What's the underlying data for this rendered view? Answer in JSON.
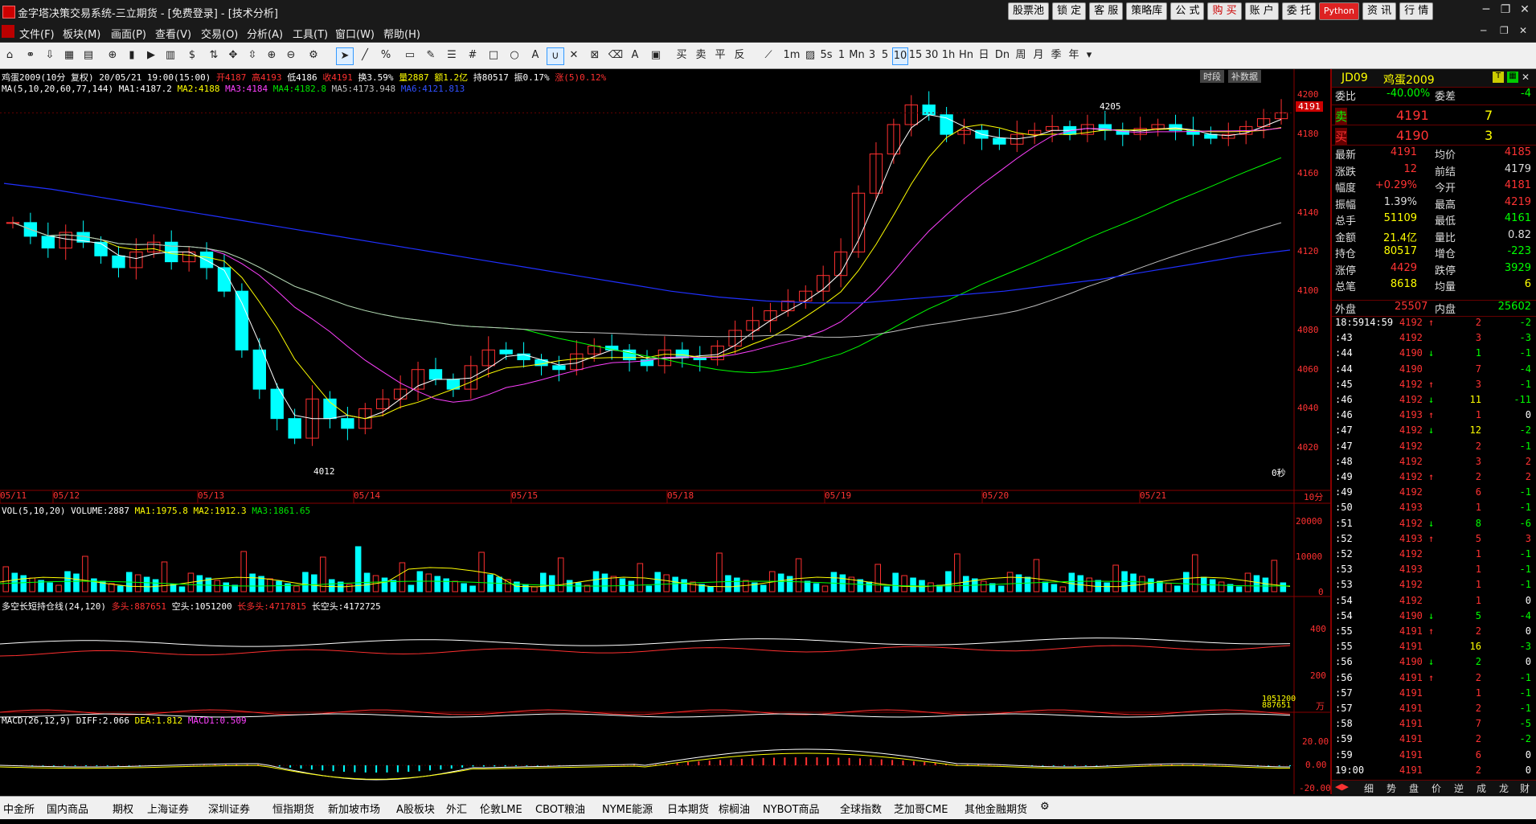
{
  "app": {
    "title": "金字塔决策交易系统-三立期货 - [免费登录] - [技术分析]",
    "top_buttons": [
      "股票池",
      "锁 定",
      "客 服",
      "策略库",
      "公 式",
      "购 买",
      "账 户",
      "委 托",
      "Python",
      "资 讯",
      "行 情"
    ],
    "menus": [
      "文件(F)",
      "板块(M)",
      "画面(P)",
      "查看(V)",
      "交易(O)",
      "分析(A)",
      "工具(T)",
      "窗口(W)",
      "帮助(H)"
    ],
    "periods": [
      "1m",
      "3",
      "5",
      "10",
      "15",
      "30",
      "1h",
      "日",
      "Dn",
      "周",
      "月",
      "季",
      "年"
    ],
    "selected_period": "10"
  },
  "chart": {
    "header": {
      "symbol": "鸡蛋2009(10分 复权)",
      "datetime": "20/05/21 19:00(15:00)",
      "open": "开4187",
      "high": "高4193",
      "low": "低4186",
      "close": "收4191",
      "turnover": "换3.59%",
      "volume": "量2887",
      "amount": "额1.2亿",
      "position": "持80517",
      "amplitude": "振0.17%",
      "change": "涨(5)0.12%"
    },
    "ma_line": {
      "label": "MA(5,10,20,60,77,144)",
      "ma1": "MA1:4187.2",
      "ma2": "MA2:4188",
      "ma3": "MA3:4184",
      "ma4": "MA4:4182.8",
      "ma5": "MA5:4173.948",
      "ma6": "MA6:4121.813"
    },
    "buttons": [
      "时段",
      "补数据"
    ],
    "price_axis": [
      "4200",
      "4180",
      "4160",
      "4140",
      "4120",
      "4100",
      "4080",
      "4060",
      "4040",
      "4020"
    ],
    "current_price_tag": "4191",
    "annot_high": "4205",
    "annot_low": "4012",
    "seconds": "0秒",
    "dates": [
      "05/11",
      "05/12",
      "05/13",
      "05/14",
      "05/15",
      "05/18",
      "05/19",
      "05/20",
      "05/21"
    ],
    "period_label": "10分",
    "vol": {
      "label": "VOL(5,10,20)",
      "volume": "VOLUME:2887",
      "ma1": "MA1:1975.8",
      "ma2": "MA2:1912.3",
      "ma3": "MA3:1861.65",
      "axis": [
        "20000",
        "10000",
        "0"
      ]
    },
    "pos": {
      "label": "多空长短持仓线(24,120)",
      "long": "多头:887651",
      "short": "空头:1051200",
      "long_long": "长多头:4717815",
      "long_short": "长空头:4172725",
      "axis": [
        "400",
        "200"
      ],
      "right_label": "1051200",
      "right_label2": "887651",
      "unit": "万"
    },
    "macd": {
      "label": "MACD(26,12,9)",
      "diff": "DIFF:2.066",
      "dea": "DEA:1.812",
      "macd": "MACD1:0.509",
      "axis": [
        "20.00",
        "0.00",
        "-20.00"
      ]
    }
  },
  "chart_data": {
    "type": "candlestick",
    "title": "鸡蛋2009(10分 复权)",
    "ylim": [
      4000,
      4210
    ],
    "x_dates": [
      "05/11",
      "05/12",
      "05/13",
      "05/14",
      "05/15",
      "05/18",
      "05/19",
      "05/20",
      "05/21"
    ],
    "high_annotation": 4205,
    "low_annotation": 4012,
    "close_series_approx": [
      4135,
      4128,
      4122,
      4130,
      4125,
      4118,
      4112,
      4120,
      4125,
      4115,
      4120,
      4112,
      4100,
      4070,
      4050,
      4035,
      4025,
      4045,
      4035,
      4030,
      4040,
      4045,
      4050,
      4060,
      4055,
      4050,
      4062,
      4070,
      4068,
      4065,
      4062,
      4060,
      4068,
      4072,
      4070,
      4065,
      4062,
      4070,
      4066,
      4065,
      4072,
      4080,
      4085,
      4090,
      4095,
      4100,
      4108,
      4120,
      4150,
      4170,
      4185,
      4195,
      4190,
      4180,
      4182,
      4178,
      4175,
      4180,
      4182,
      4184,
      4180,
      4185,
      4182,
      4180,
      4183,
      4185,
      4182,
      4180,
      4178,
      4180,
      4184,
      4188,
      4191
    ],
    "ma_series": [
      {
        "name": "MA1",
        "color": "#ffffff"
      },
      {
        "name": "MA2",
        "color": "#ffff00"
      },
      {
        "name": "MA3",
        "color": "#ff40ff"
      },
      {
        "name": "MA4",
        "color": "#00ff00"
      },
      {
        "name": "MA5",
        "color": "#c0c0c0"
      },
      {
        "name": "MA6",
        "color": "#0000ff"
      }
    ],
    "ma6_approx": [
      4155,
      4152,
      4148,
      4144,
      4140,
      4136,
      4132,
      4128,
      4124,
      4120,
      4116,
      4112,
      4108,
      4104,
      4100,
      4097,
      4095,
      4094,
      4094,
      4096,
      4098,
      4100,
      4103,
      4106,
      4110,
      4114,
      4118,
      4121
    ]
  },
  "panel": {
    "code": "JD09",
    "name": "鸡蛋2009",
    "weibi_label": "委比",
    "weibi": "-40.00%",
    "weicha_label": "委差",
    "weicha": "-4",
    "sell_label": "卖",
    "sell_price": "4191",
    "sell_vol": "7",
    "buy_label": "买",
    "buy_price": "4190",
    "buy_vol": "3",
    "stats": [
      [
        "最新",
        "4191",
        "均价",
        "4185"
      ],
      [
        "涨跌",
        "12",
        "前结",
        "4179"
      ],
      [
        "幅度",
        "+0.29%",
        "今开",
        "4181"
      ],
      [
        "振幅",
        "1.39%",
        "最高",
        "4219"
      ],
      [
        "总手",
        "51109",
        "最低",
        "4161"
      ],
      [
        "金额",
        "21.4亿",
        "量比",
        "0.82"
      ],
      [
        "持仓",
        "80517",
        "增仓",
        "-223"
      ],
      [
        "涨停",
        "4429",
        "跌停",
        "3929"
      ],
      [
        "总笔",
        "8618",
        "均量",
        "6"
      ]
    ],
    "outer_label": "外盘",
    "outer": "25507",
    "inner_label": "内盘",
    "inner": "25602",
    "ticks": [
      [
        "18:59",
        "14:59",
        "4192",
        "↑",
        "2",
        "-2"
      ],
      [
        ":43",
        "",
        "4192",
        "",
        "3",
        "-3"
      ],
      [
        ":44",
        "",
        "4190",
        "↓",
        "1",
        "-1"
      ],
      [
        ":44",
        "",
        "4190",
        "",
        "7",
        "-4"
      ],
      [
        ":45",
        "",
        "4192",
        "↑",
        "3",
        "-1"
      ],
      [
        ":46",
        "",
        "4192",
        "↓",
        "11",
        "-11"
      ],
      [
        ":46",
        "",
        "4193",
        "↑",
        "1",
        "0"
      ],
      [
        ":47",
        "",
        "4192",
        "↓",
        "12",
        "-2"
      ],
      [
        ":47",
        "",
        "4192",
        "",
        "2",
        "-1"
      ],
      [
        ":48",
        "",
        "4192",
        "",
        "3",
        "2"
      ],
      [
        ":49",
        "",
        "4192",
        "↑",
        "2",
        "2"
      ],
      [
        ":49",
        "",
        "4192",
        "",
        "6",
        "-1"
      ],
      [
        ":50",
        "",
        "4193",
        "",
        "1",
        "-1"
      ],
      [
        ":51",
        "",
        "4192",
        "↓",
        "8",
        "-6"
      ],
      [
        ":52",
        "",
        "4193",
        "↑",
        "5",
        "3"
      ],
      [
        ":52",
        "",
        "4192",
        "",
        "1",
        "-1"
      ],
      [
        ":53",
        "",
        "4193",
        "",
        "1",
        "-1"
      ],
      [
        ":53",
        "",
        "4192",
        "",
        "1",
        "-1"
      ],
      [
        ":54",
        "",
        "4192",
        "",
        "1",
        "0"
      ],
      [
        ":54",
        "",
        "4190",
        "↓",
        "5",
        "-4"
      ],
      [
        ":55",
        "",
        "4191",
        "↑",
        "2",
        "0"
      ],
      [
        ":55",
        "",
        "4191",
        "",
        "16",
        "-3"
      ],
      [
        ":56",
        "",
        "4190",
        "↓",
        "2",
        "0"
      ],
      [
        ":56",
        "",
        "4191",
        "↑",
        "2",
        "-1"
      ],
      [
        ":57",
        "",
        "4191",
        "",
        "1",
        "-1"
      ],
      [
        ":57",
        "",
        "4191",
        "",
        "2",
        "-1"
      ],
      [
        ":58",
        "",
        "4191",
        "",
        "7",
        "-5"
      ],
      [
        ":59",
        "",
        "4191",
        "",
        "2",
        "-2"
      ],
      [
        ":59",
        "",
        "4191",
        "",
        "6",
        "0"
      ],
      [
        "19:00",
        "",
        "4191",
        "",
        "2",
        "0"
      ]
    ],
    "bottom_tabs": [
      "细",
      "势",
      "盘",
      "价",
      "逆",
      "成",
      "龙",
      "财"
    ]
  },
  "bottom_tabs": [
    "中金所",
    "国内商品",
    "期权",
    "上海证券",
    "深圳证券",
    "恒指期货",
    "新加坡市场",
    "A股板块",
    "外汇",
    "伦敦LME",
    "CBOT粮油",
    "NYME能源",
    "日本期货",
    "棕榈油",
    "NYBOT商品",
    "全球指数",
    "芝加哥CME",
    "其他金融期货"
  ]
}
